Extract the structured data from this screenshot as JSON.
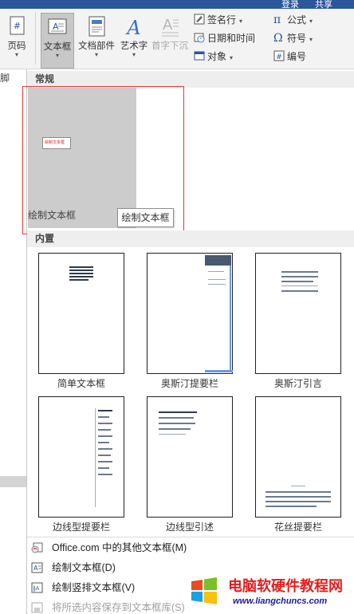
{
  "title_strip": {
    "text_1": "登录",
    "text_2": "共享"
  },
  "ribbon": {
    "page_number_label": "页码",
    "textbox_label": "文本框",
    "doc_parts_label": "文档部件",
    "wordart_label": "艺术字",
    "dropcap_label": "首字下沉",
    "signature_line_label": "签名行",
    "datetime_label": "日期和时间",
    "object_label": "对象",
    "equation_label": "公式",
    "symbol_label": "符号",
    "number_label": "编号"
  },
  "left_strip": {
    "label": "脚"
  },
  "panel": {
    "section_general": "常规",
    "section_builtin": "内置",
    "selected_tile": {
      "caption": "绘制文本框",
      "sample_text": "绘制文本框"
    },
    "tooltip": "绘制文本框",
    "builtin_tiles": [
      {
        "caption": "简单文本框"
      },
      {
        "caption": "奥斯汀提要栏"
      },
      {
        "caption": "奥斯汀引言"
      },
      {
        "caption": "边线型提要栏"
      },
      {
        "caption": "边线型引述"
      },
      {
        "caption": "花丝提要栏"
      }
    ],
    "menu_items": [
      {
        "label": "Office.com 中的其他文本框(M)",
        "disabled": false
      },
      {
        "label": "绘制文本框(D)",
        "disabled": false
      },
      {
        "label": "绘制竖排文本框(V)",
        "disabled": false
      },
      {
        "label": "将所选内容保存到文本框库(S)",
        "disabled": true
      }
    ]
  },
  "watermark": {
    "title": "电脑软硬件教程网",
    "url": "www.liangchuncs.com"
  },
  "colors": {
    "ribbon_bg": "#f3f3f3",
    "title_bar": "#2b579a",
    "highlight_frame": "#e33a3a",
    "section_bg": "#eeeeee"
  }
}
